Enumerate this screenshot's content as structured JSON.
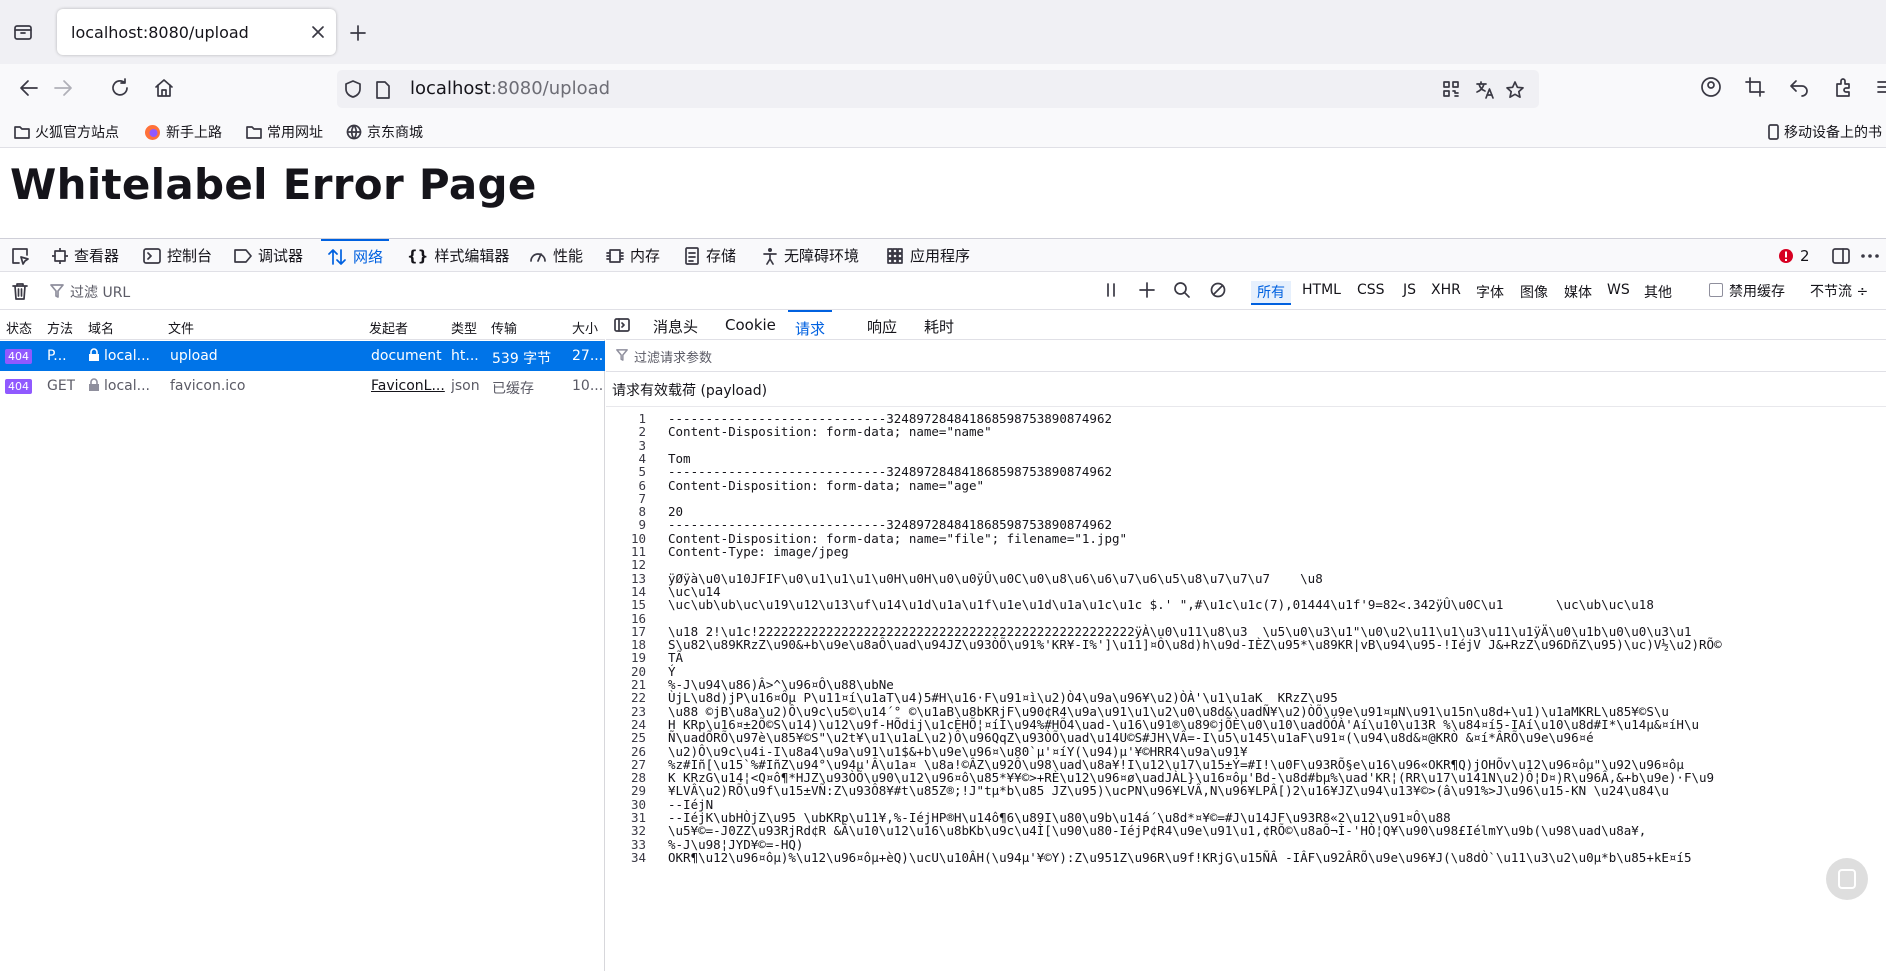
{
  "browser": {
    "tab_title": "localhost:8080/upload",
    "url_host": "localhost",
    "url_path": ":8080/upload",
    "bookmarks": [
      "火狐官方站点",
      "新手上路",
      "常用网址",
      "京东商城"
    ],
    "mobile_bookmarks": "移动设备上的书"
  },
  "page": {
    "title": "Whitelabel Error Page"
  },
  "devtools": {
    "tabs": [
      "查看器",
      "控制台",
      "调试器",
      "网络",
      "样式编辑器",
      "性能",
      "内存",
      "存储",
      "无障碍环境",
      "应用程序"
    ],
    "active_tab": "网络",
    "error_count": "2",
    "filter_placeholder": "过滤 URL",
    "type_filters": [
      "所有",
      "HTML",
      "CSS",
      "JS",
      "XHR",
      "字体",
      "图像",
      "媒体",
      "WS",
      "其他"
    ],
    "disable_cache": "禁用缓存",
    "throttle": "不节流 ÷",
    "columns": [
      "状态",
      "方法",
      "域名",
      "文件",
      "发起者",
      "类型",
      "传输",
      "大小"
    ],
    "requests": [
      {
        "status": "404",
        "method": "P...",
        "domain": "local...",
        "file": "upload",
        "initiator": "document",
        "type": "ht...",
        "transfer": "539 字节",
        "size": "27..."
      },
      {
        "status": "404",
        "method": "GET",
        "domain": "local...",
        "file": "favicon.ico",
        "initiator": "FaviconL...",
        "type": "json",
        "transfer": "已缓存",
        "size": "10..."
      }
    ],
    "side_tabs": [
      "消息头",
      "Cookie",
      "请求",
      "响应",
      "耗时"
    ],
    "active_side_tab": "请求",
    "params_filter": "过滤请求参数",
    "payload_label": "请求有效载荷 (payload)",
    "code_lines": [
      "-----------------------------324897284841868598753890874962",
      "Content-Disposition: form-data; name=\"name\"",
      "",
      "Tom",
      "-----------------------------324897284841868598753890874962",
      "Content-Disposition: form-data; name=\"age\"",
      "",
      "20",
      "-----------------------------324897284841868598753890874962",
      "Content-Disposition: form-data; name=\"file\"; filename=\"1.jpg\"",
      "Content-Type: image/jpeg",
      "",
      "ÿØÿà\\u0\\u10JFIF\\u0\\u1\\u1\\u1\\u0H\\u0H\\u0\\u0ÿÛ\\u0C\\u0\\u8\\u6\\u6\\u7\\u6\\u5\\u8\\u7\\u7\\u7    \\u8",
      "\\uc\\u14",
      "\\uc\\ub\\ub\\uc\\u19\\u12\\u13\\uf\\u14\\u1d\\u1a\\u1f\\u1e\\u1d\\u1a\\u1c\\u1c $.' \",#\\u1c\\u1c(7),01444\\u1f'9=82<.342ÿÛ\\u0C\\u1       \\uc\\ub\\uc\\u18",
      "",
      "\\u18 2!\\u1c!22222222222222222222222222222222222222222222222222ÿÀ\\u0\\u11\\u8\\u3  \\u5\\u0\\u3\\u1\"\\u0\\u2\\u11\\u1\\u3\\u11\\u1ÿÄ\\u0\\u1b\\u0\\u0\\u3\\u1",
      "S\\u82\\u89KRzZ\\u90&+b\\u9e\\u8aÔ\\uad\\u94JZ\\u93ÒÕ\\u91%'KR¥-I%']\\u11]¤Ô\\u8d)h\\u9d-IÈZ\\u95*\\u89KR|vB\\u94\\u95-!IéjV J&+RzZ\\u96DñZ\\u95)\\uc)V½\\u2)RÕ©",
      "TÃ",
      "Ý",
      "%-J\\u94\\u86)Â>^\\u96¤Ô\\u88\\ubNe",
      "ÙjL\\u8d)jP\\u16¤Ôµ P\\u11¤í\\u1aT\\u4)5#H\\u16·F\\u91¤ì\\u2)Ò4\\u9a\\u96¥\\u2)ÒÀ'\\u1\\u1aK  KRzZ\\u95",
      "\\u88 ©jB\\u8a\\u2)Ô\\u9c\\u5©\\u14´° ©\\u1aB\\u8bKRjF\\u90¢R4\\u9a\\u91\\u1\\u2\\u0\\u8d&\\uadÑ¥\\u2)ÒÕ\\u9e\\u91¤µN\\u91\\u15n\\u8d+\\u1)\\u1aMKRL\\u85¥©S\\u",
      "H KRp\\u16¤±2Õ©S\\u14)\\u12\\u9f-HÕdij\\u1cÈHÕ¦¤íI\\u94%#HÕ4\\uad-\\u16\\u91®\\u89©jÕÈ\\u0\\u10\\uadÕÓÀ'Aí\\u10\\u13R %\\u84¤í5-IAí\\u10\\u8d#I*\\u14µ&¤íH\\u",
      "Ñ\\uadÕRÕ\\u97è\\u85¥©S\"\\u2t¥\\u1\\u1aL\\u2)Ô\\u96QqZ\\u93ÒÕ\\uad\\u14U©S#JH\\VÂ=-I\\u5\\u145\\u1aF\\u91¤(\\u94\\u8d&¤@KRÒ &¤í*ÂRÕ\\u9e\\u96¤é",
      "\\u2)Ô\\u9c\\u4i-I\\u8a4\\u9a\\u91\\u1$&+b\\u9e\\u96¤\\u80`µ'¤íY(\\u94)µ'¥©HRR4\\u9a\\u91¥",
      "%z#Iñ[\\u15`%#IñZ\\u94°\\u94µ'Â\\u1a¤ \\u8a!©ÂZ\\u92Ô\\u98\\uad\\u8a¥!I\\u12\\u17\\u15±Ý=#I!\\u0F\\u93RÕ§e\\u16\\u96«OKR¶Q)jOHÕv\\u12\\u96¤ôµ\"\\u92\\u96¤ôµ",
      "K KRzG\\u14¦<Q¤ô¶*HJZ\\u93ÒÕ\\u90\\u12\\u96¤ô\\u85*¥¥©>+RÈ\\u12\\u96¤ø\\uadJÀL}\\u16¤ôµ'Bd-\\u8d#bµ%\\uad'KR¦(RR\\u17\\u141N\\u2)Ô¦D¤)R\\u96Â,&+b\\u9e)·F\\u9",
      "¥LVÂ\\u2)RÕ\\u9f\\u15±VÑ:Z\\u93Ô8¥#t\\u85Z®;!J\"tµ*b\\u85 JZ\\u95)\\ucPN\\u96¥LVÂ,N\\u96¥LPÂ[)2\\u16¥JZ\\u94\\u13¥©>(â\\u91%>J\\u96\\u15-KN \\u24\\u84\\u",
      "--IéjN",
      "--IéjK\\ubHÒjZ\\u95 \\ubKRp\\u11¥,%-IéjHP®H\\u14ô¶6\\u89I\\u80\\u9b\\u14á´\\u8d*¤¥©=#J\\u14JF\\u93R8«2\\u12\\u91¤Ô\\u88",
      "\\u5¥©=-J0ZZ\\u93RjRd¢R &Â\\u10\\u12\\u16\\u8bKb\\u9c\\u4Ì[\\u90\\u80-IéjP¢R4\\u9e\\u91\\u1,¢RÕ©\\u8aÕ¬Ì-'HÒ¦Q¥\\u90\\u98£IélmY\\u9b(\\u98\\uad\\u8a¥,",
      "%-J\\u98¦JYD¥©=-HQ)",
      "OKR¶\\u12\\u96¤ôµ)%\\u12\\u96¤ôµ+èQ)\\ucU\\u10ÂH(\\u94µ'¥©Y):Z\\u951Z\\u96R\\u9f!KRjG\\u15ÑÂ -IÂF\\u92ÂRÕ\\u9e\\u96¥J(\\u8dÒ`\\u11\\u3\\u2\\u0µ*b\\u85+kE¤í5"
    ]
  }
}
